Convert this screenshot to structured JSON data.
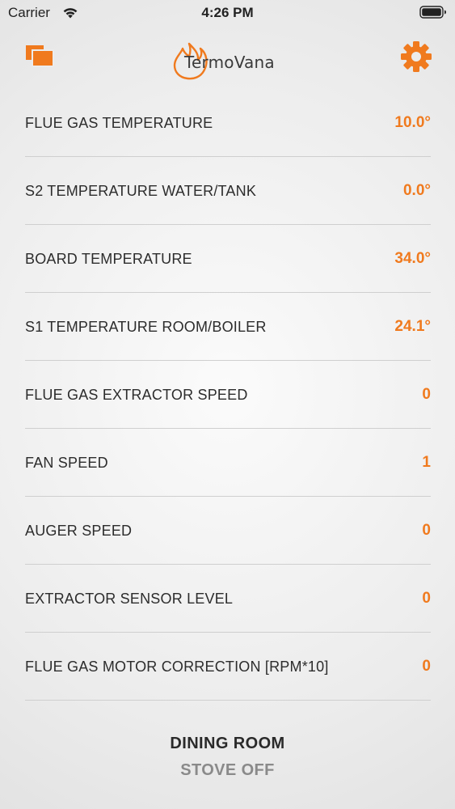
{
  "status_bar": {
    "carrier": "Carrier",
    "time": "4:26 PM",
    "icons": [
      "wifi-icon",
      "battery-icon"
    ]
  },
  "header": {
    "app_name": "TermoVana",
    "left_icon": "rooms-icon",
    "right_icon": "settings-gear-icon",
    "accent_color": "#f07a1e"
  },
  "rows": [
    {
      "label": "FLUE GAS TEMPERATURE",
      "value": "10.0°"
    },
    {
      "label": "S2 TEMPERATURE WATER/TANK",
      "value": "0.0°"
    },
    {
      "label": "BOARD TEMPERATURE",
      "value": "34.0°"
    },
    {
      "label": "S1 TEMPERATURE ROOM/BOILER",
      "value": "24.1°"
    },
    {
      "label": "FLUE GAS EXTRACTOR SPEED",
      "value": "0"
    },
    {
      "label": "FAN SPEED",
      "value": "1"
    },
    {
      "label": "AUGER SPEED",
      "value": "0"
    },
    {
      "label": "EXTRACTOR SENSOR LEVEL",
      "value": "0"
    },
    {
      "label": "FLUE GAS MOTOR CORRECTION [RPM*10]",
      "value": "0"
    }
  ],
  "footer": {
    "room_name": "DINING ROOM",
    "stove_status": "STOVE OFF"
  }
}
